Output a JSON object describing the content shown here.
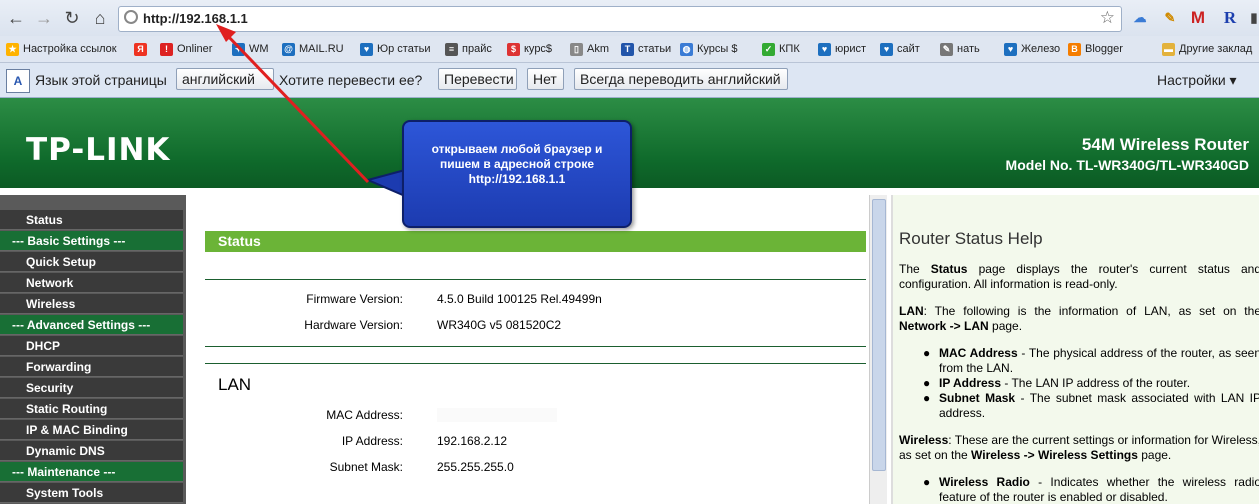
{
  "browser": {
    "url": "http://192.168.1.1",
    "nav": {
      "back": "←",
      "forward": "→",
      "reload": "↻",
      "home": "⌂"
    },
    "bookmarks": [
      {
        "label": "Настройка ссылок",
        "icon": "bookmark-star-icon",
        "color": "#ffb300"
      },
      {
        "label": "",
        "icon": "yandex-icon",
        "color": "#e32"
      },
      {
        "label": "Onliner",
        "icon": "onliner-icon",
        "color": "#d22"
      },
      {
        "label": "WM",
        "icon": "webmoney-icon",
        "color": "#1d6fbf"
      },
      {
        "label": "MAIL.RU",
        "icon": "at-icon",
        "color": "#1d6fbf"
      },
      {
        "label": "Юр статьи",
        "icon": "heart-icon",
        "color": "#1d6fbf"
      },
      {
        "label": "прайс",
        "icon": "doc-icon",
        "color": "#555"
      },
      {
        "label": "курс$",
        "icon": "kurs-icon",
        "color": "#d33"
      },
      {
        "label": "Akm",
        "icon": "page-icon",
        "color": "#888"
      },
      {
        "label": "статьи",
        "icon": "text-icon",
        "color": "#2255aa"
      },
      {
        "label": "Курсы $",
        "icon": "globe-icon",
        "color": "#3a7bd5"
      },
      {
        "label": "КПК",
        "icon": "leaf-icon",
        "color": "#3a3"
      },
      {
        "label": "юрист",
        "icon": "heart-icon",
        "color": "#1d6fbf"
      },
      {
        "label": "сайт",
        "icon": "heart-icon",
        "color": "#1d6fbf"
      },
      {
        "label": "нать",
        "icon": "pencil-icon",
        "color": "#777"
      },
      {
        "label": "Железо",
        "icon": "heart-icon",
        "color": "#1d6fbf"
      },
      {
        "label": "Blogger",
        "icon": "blogger-icon",
        "color": "#f57d00"
      },
      {
        "label": "Другие заклад",
        "icon": "folder-icon",
        "color": "#e3b23c"
      }
    ],
    "translate": {
      "prompt": "Язык этой страницы",
      "language": "английский",
      "question": "Хотите перевести ее?",
      "translate_btn": "Перевести",
      "no_btn": "Нет",
      "always_btn": "Всегда переводить английский",
      "settings": "Настройки ▾"
    }
  },
  "router": {
    "logo": "TP-LINK",
    "product": "54M Wireless Router",
    "model": "Model No. TL-WR340G/TL-WR340GD",
    "menu": [
      {
        "label": "Status",
        "header": false
      },
      {
        "label": "--- Basic Settings ---",
        "header": true
      },
      {
        "label": "Quick Setup",
        "header": false
      },
      {
        "label": "Network",
        "header": false
      },
      {
        "label": "Wireless",
        "header": false
      },
      {
        "label": "--- Advanced Settings ---",
        "header": true
      },
      {
        "label": "DHCP",
        "header": false
      },
      {
        "label": "Forwarding",
        "header": false
      },
      {
        "label": "Security",
        "header": false
      },
      {
        "label": "Static Routing",
        "header": false
      },
      {
        "label": "IP & MAC Binding",
        "header": false
      },
      {
        "label": "Dynamic DNS",
        "header": false
      },
      {
        "label": "--- Maintenance ---",
        "header": true
      },
      {
        "label": "System Tools",
        "header": false
      }
    ],
    "status_title": "Status",
    "firmware_label": "Firmware Version:",
    "firmware_value": "4.5.0 Build 100125 Rel.49499n",
    "hardware_label": "Hardware Version:",
    "hardware_value": "WR340G v5 081520C2",
    "lan_title": "LAN",
    "mac_label": "MAC Address:",
    "mac_value": "",
    "ip_label": "IP Address:",
    "ip_value": "192.168.2.12",
    "mask_label": "Subnet Mask:",
    "mask_value": "255.255.255.0",
    "help": {
      "title": "Router Status Help",
      "p1a": "The ",
      "p1b": "Status",
      "p1c": " page displays the router's current status and configuration. All information is read-only.",
      "p2a": "LAN",
      "p2b": ": The following is the information of LAN, as set on the ",
      "p2c": "Network -> LAN",
      "p2d": " page.",
      "b1a": "MAC Address",
      "b1b": " - The physical address of the router, as seen from the LAN.",
      "b2a": "IP Address",
      "b2b": " - The LAN IP address of the router.",
      "b3a": "Subnet Mask",
      "b3b": " - The subnet mask associated with LAN IP address.",
      "p3a": "Wireless",
      "p3b": ": These are the current settings or information for Wireless, as set on the ",
      "p3c": "Wireless -> Wireless Settings",
      "p3d": " page.",
      "b4a": "Wireless Radio",
      "b4b": " - Indicates whether the wireless radio feature of the router is enabled or disabled."
    }
  },
  "annotation": {
    "line1": "открываем любой браузер и",
    "line2": "пишем в адресной строке",
    "line3": "http://192.168.1.1",
    "arrow_color": "#e02020"
  }
}
